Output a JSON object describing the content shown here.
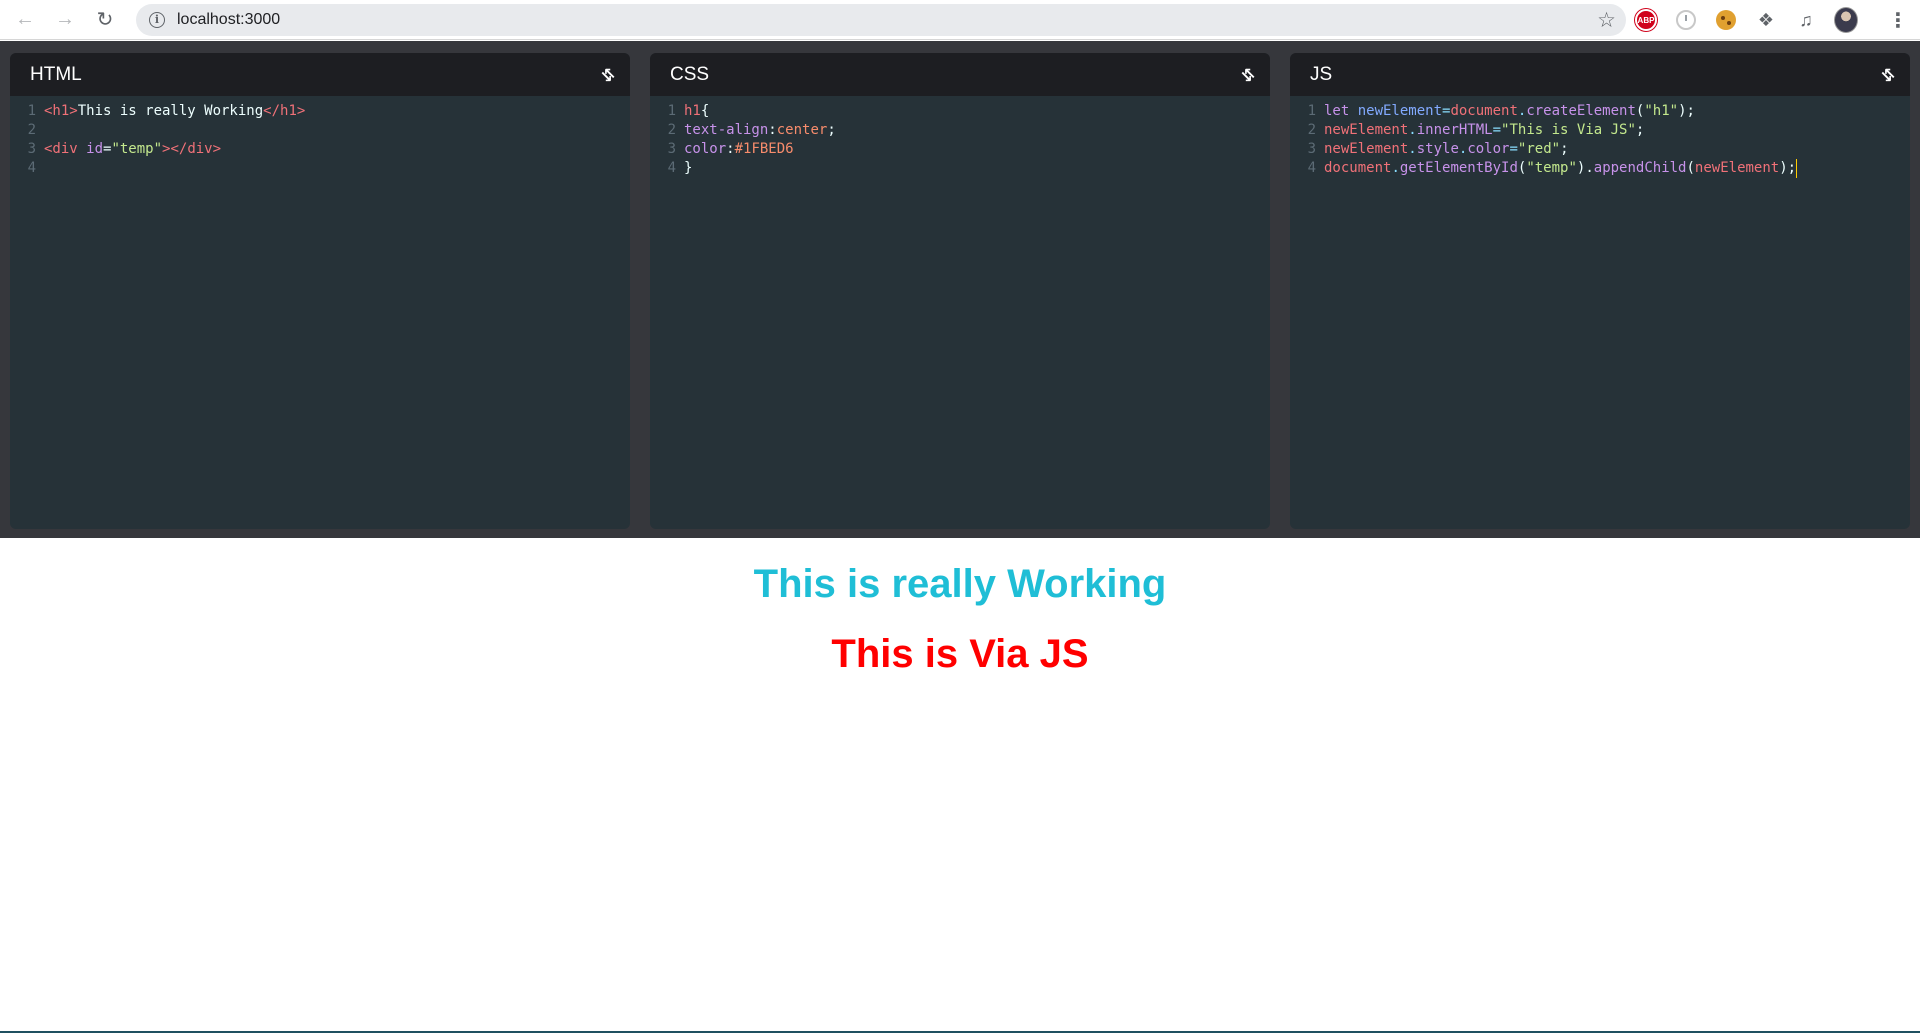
{
  "browser": {
    "url": "localhost:3000"
  },
  "icons": {
    "back": "arrow-left-icon",
    "forward": "arrow-right-icon",
    "reload": "reload-icon",
    "info": "info-icon",
    "star": "star-icon",
    "extensions": "puzzle-icon",
    "menu": "kebab-menu-icon",
    "collapse": "collapse-icon"
  },
  "extensions": {
    "abp_label": "ABP"
  },
  "panes": {
    "html": {
      "title": "HTML",
      "lines": [
        {
          "num": "1",
          "parts": [
            {
              "t": "<h1>",
              "c": "tag"
            },
            {
              "t": "This is really Working",
              "c": "txt"
            },
            {
              "t": "</h1>",
              "c": "tag"
            }
          ]
        },
        {
          "num": "2",
          "parts": []
        },
        {
          "num": "3",
          "parts": [
            {
              "t": "<div ",
              "c": "tag"
            },
            {
              "t": "id",
              "c": "attr"
            },
            {
              "t": "=",
              "c": "txt"
            },
            {
              "t": "\"temp\"",
              "c": "str"
            },
            {
              "t": "></div>",
              "c": "tag"
            }
          ]
        },
        {
          "num": "4",
          "parts": []
        }
      ]
    },
    "css": {
      "title": "CSS",
      "lines": [
        {
          "num": "1",
          "parts": [
            {
              "t": "h1",
              "c": "tag"
            },
            {
              "t": "{",
              "c": "txt"
            }
          ]
        },
        {
          "num": "2",
          "parts": [
            {
              "t": "text-align",
              "c": "attr"
            },
            {
              "t": ":",
              "c": "txt"
            },
            {
              "t": "center",
              "c": "prop"
            },
            {
              "t": ";",
              "c": "txt"
            }
          ]
        },
        {
          "num": "3",
          "parts": [
            {
              "t": "color",
              "c": "attr"
            },
            {
              "t": ":",
              "c": "txt"
            },
            {
              "t": "#1FBED6",
              "c": "prop"
            }
          ]
        },
        {
          "num": "4",
          "parts": [
            {
              "t": "}",
              "c": "txt"
            }
          ]
        }
      ]
    },
    "js": {
      "title": "JS",
      "lines": [
        {
          "num": "1",
          "parts": [
            {
              "t": "let ",
              "c": "kw"
            },
            {
              "t": "newElement",
              "c": "var"
            },
            {
              "t": "=",
              "c": "punc"
            },
            {
              "t": "document",
              "c": "obj"
            },
            {
              "t": ".",
              "c": "punc"
            },
            {
              "t": "createElement",
              "c": "fn"
            },
            {
              "t": "(",
              "c": "txt"
            },
            {
              "t": "\"h1\"",
              "c": "str"
            },
            {
              "t": ");",
              "c": "txt"
            }
          ]
        },
        {
          "num": "2",
          "parts": [
            {
              "t": "newElement",
              "c": "obj"
            },
            {
              "t": ".",
              "c": "punc"
            },
            {
              "t": "innerHTML",
              "c": "fn"
            },
            {
              "t": "=",
              "c": "punc"
            },
            {
              "t": "\"This is Via JS\"",
              "c": "str"
            },
            {
              "t": ";",
              "c": "txt"
            }
          ]
        },
        {
          "num": "3",
          "parts": [
            {
              "t": "newElement",
              "c": "obj"
            },
            {
              "t": ".",
              "c": "punc"
            },
            {
              "t": "style",
              "c": "fn"
            },
            {
              "t": ".",
              "c": "punc"
            },
            {
              "t": "color",
              "c": "fn"
            },
            {
              "t": "=",
              "c": "punc"
            },
            {
              "t": "\"red\"",
              "c": "str"
            },
            {
              "t": ";",
              "c": "txt"
            }
          ]
        },
        {
          "num": "4",
          "parts": [
            {
              "t": "document",
              "c": "obj"
            },
            {
              "t": ".",
              "c": "punc"
            },
            {
              "t": "getElementById",
              "c": "fn"
            },
            {
              "t": "(",
              "c": "txt"
            },
            {
              "t": "\"temp\"",
              "c": "str"
            },
            {
              "t": ").",
              "c": "txt"
            },
            {
              "t": "appendChild",
              "c": "fn"
            },
            {
              "t": "(",
              "c": "txt"
            },
            {
              "t": "newElement",
              "c": "obj"
            },
            {
              "t": ");",
              "c": "txt"
            }
          ]
        }
      ]
    }
  },
  "preview": {
    "heading_1": "This is really Working",
    "heading_1_color": "#1FBED6",
    "heading_2": "This is Via JS",
    "heading_2_color": "#ff0000"
  },
  "colors": {
    "editor_bg": "#263238",
    "pane_header_bg": "#1d1e22",
    "editor_area_bg": "#36373c"
  }
}
